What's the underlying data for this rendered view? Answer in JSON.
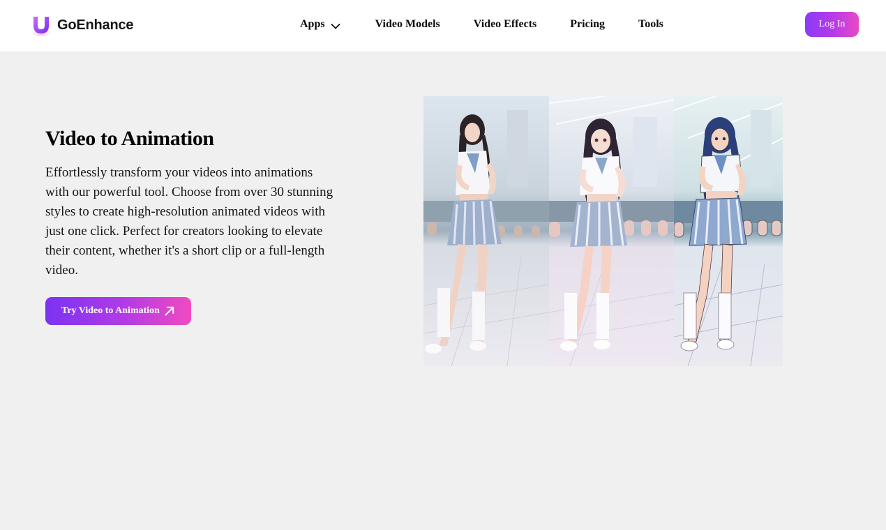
{
  "brand": {
    "name": "GoEnhance",
    "logo_icon": "goenhance-logo-icon"
  },
  "nav": {
    "items": [
      {
        "label": "Apps",
        "icon": "chevron-down-icon"
      },
      {
        "label": "Video Models"
      },
      {
        "label": "Video Effects"
      },
      {
        "label": "Pricing"
      },
      {
        "label": "Tools"
      }
    ],
    "login_label": "Log In"
  },
  "hero": {
    "title": "Video to Animation",
    "description": "Effortlessly transform your videos into animations with our powerful tool. Choose from over 30 stunning styles to create high-resolution animated videos with just one click. Perfect for creators looking to elevate their content, whether it's a short clip or a full-length video.",
    "cta_label": "Try Video to Animation",
    "cta_icon": "arrow-up-right-icon"
  },
  "preview": {
    "panels": [
      "original-video-frame",
      "anime-style-frame",
      "comic-style-frame"
    ]
  },
  "colors": {
    "accent_start": "#7a33f3",
    "accent_end": "#f04bbf",
    "page_background": "#f0f0f0",
    "navbar_background": "#ffffff"
  }
}
